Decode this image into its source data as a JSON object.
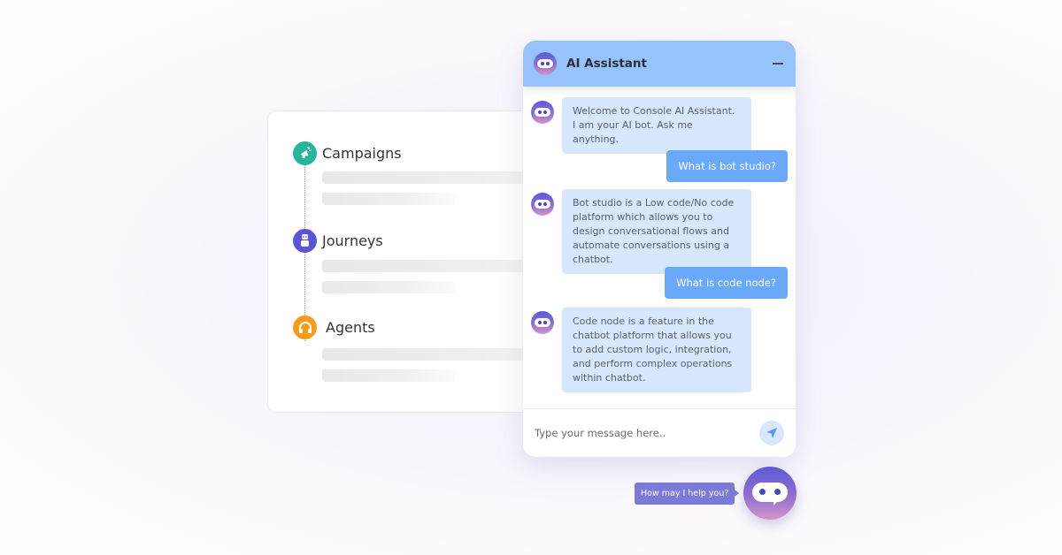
{
  "background": {
    "sections": [
      {
        "label": "Campaigns",
        "icon": "megaphone-icon",
        "color": "#27b59a"
      },
      {
        "label": "Journeys",
        "icon": "robot-icon",
        "color": "#5b55d6"
      },
      {
        "label": "Agents",
        "icon": "headphones-icon",
        "color": "#f89a1c"
      }
    ]
  },
  "chat": {
    "title": "AI Assistant",
    "header_color": "#97c3fc",
    "messages": [
      {
        "sender": "bot",
        "text": "Welcome to Console AI Assistant. I am your AI bot. Ask me anything."
      },
      {
        "sender": "user",
        "text": "What is bot studio?"
      },
      {
        "sender": "bot",
        "text": "Bot studio is a Low code/No code platform which allows you to design conversational flows and automate conversations using a chatbot."
      },
      {
        "sender": "user",
        "text": "What is code node?"
      },
      {
        "sender": "bot",
        "text": "Code node is a feature in the chatbot platform that allows you to add custom logic, integration, and perform complex operations within chatbot."
      }
    ],
    "input": {
      "placeholder": "Type your message here..",
      "value": ""
    },
    "bot_bubble_color": "#d7e7fd",
    "user_bubble_color": "#6aa8fa"
  },
  "launcher": {
    "prompt": "How may I help you?"
  }
}
